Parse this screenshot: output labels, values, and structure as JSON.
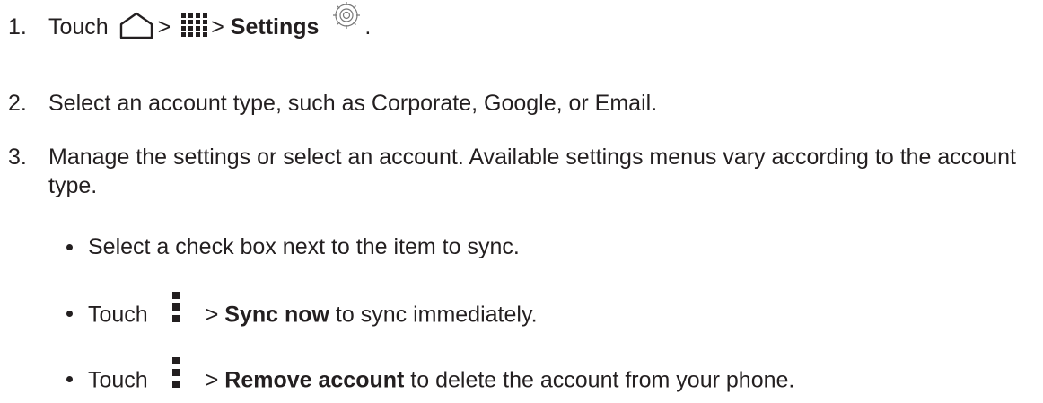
{
  "steps": [
    {
      "number": "1.",
      "prefix": "Touch",
      "sep1": ">",
      "sep2": ">",
      "bold": "Settings",
      "suffix": "."
    },
    {
      "number": "2.",
      "text": "Select an account type, such as Corporate, Google, or Email."
    },
    {
      "number": "3.",
      "text": "Manage the settings or select an account. Available settings menus vary according to the account type."
    }
  ],
  "bullets": [
    {
      "text": "Select a check box next to the item to sync."
    },
    {
      "prefix": "Touch",
      "sep": ">",
      "bold": "Sync now",
      "suffix": "to sync immediately."
    },
    {
      "prefix": "Touch",
      "sep": ">",
      "bold": "Remove account",
      "suffix": "to delete the account from your phone."
    }
  ],
  "icons": {
    "home": "home-icon",
    "apps": "apps-icon",
    "settings": "gear-icon",
    "menu": "menu-icon"
  }
}
